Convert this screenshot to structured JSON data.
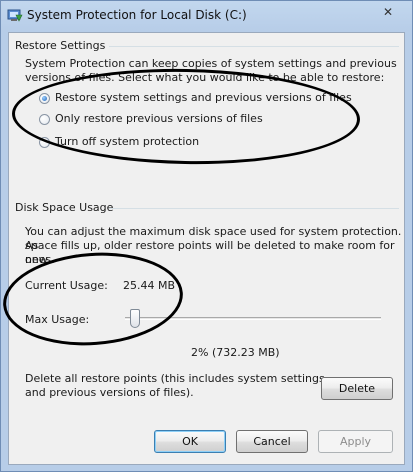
{
  "window": {
    "title": "System Protection for Local Disk (C:)",
    "close_glyph": "✕"
  },
  "restore_settings": {
    "group_title": "Restore Settings",
    "description_line1": "System Protection can keep copies of system settings and previous",
    "description_line2": "versions of files. Select what you would like to be able to restore:",
    "options": [
      {
        "label": "Restore system settings and previous versions of files",
        "selected": true
      },
      {
        "label": "Only restore previous versions of files",
        "selected": false
      },
      {
        "label": "Turn off system protection",
        "selected": false
      }
    ]
  },
  "disk_space": {
    "group_title": "Disk Space Usage",
    "description_line1": "You can adjust the maximum disk space used for system protection. As",
    "description_line2": "space fills up, older restore points will be deleted to make room for new",
    "description_line3": "ones.",
    "current_usage_label": "Current Usage:",
    "current_usage_value": "25.44 MB",
    "max_usage_label": "Max Usage:",
    "slider_fraction": 0.02,
    "max_usage_readout": "2% (732.23 MB)",
    "delete_text_line1": "Delete all restore points (this includes system settings",
    "delete_text_line2": "and previous versions of files).",
    "delete_button": "Delete"
  },
  "buttons": {
    "ok": "OK",
    "cancel": "Cancel",
    "apply": "Apply"
  },
  "accent_colors": {
    "titlebar": "#b7cde8",
    "annotation_ink": "#000000"
  }
}
